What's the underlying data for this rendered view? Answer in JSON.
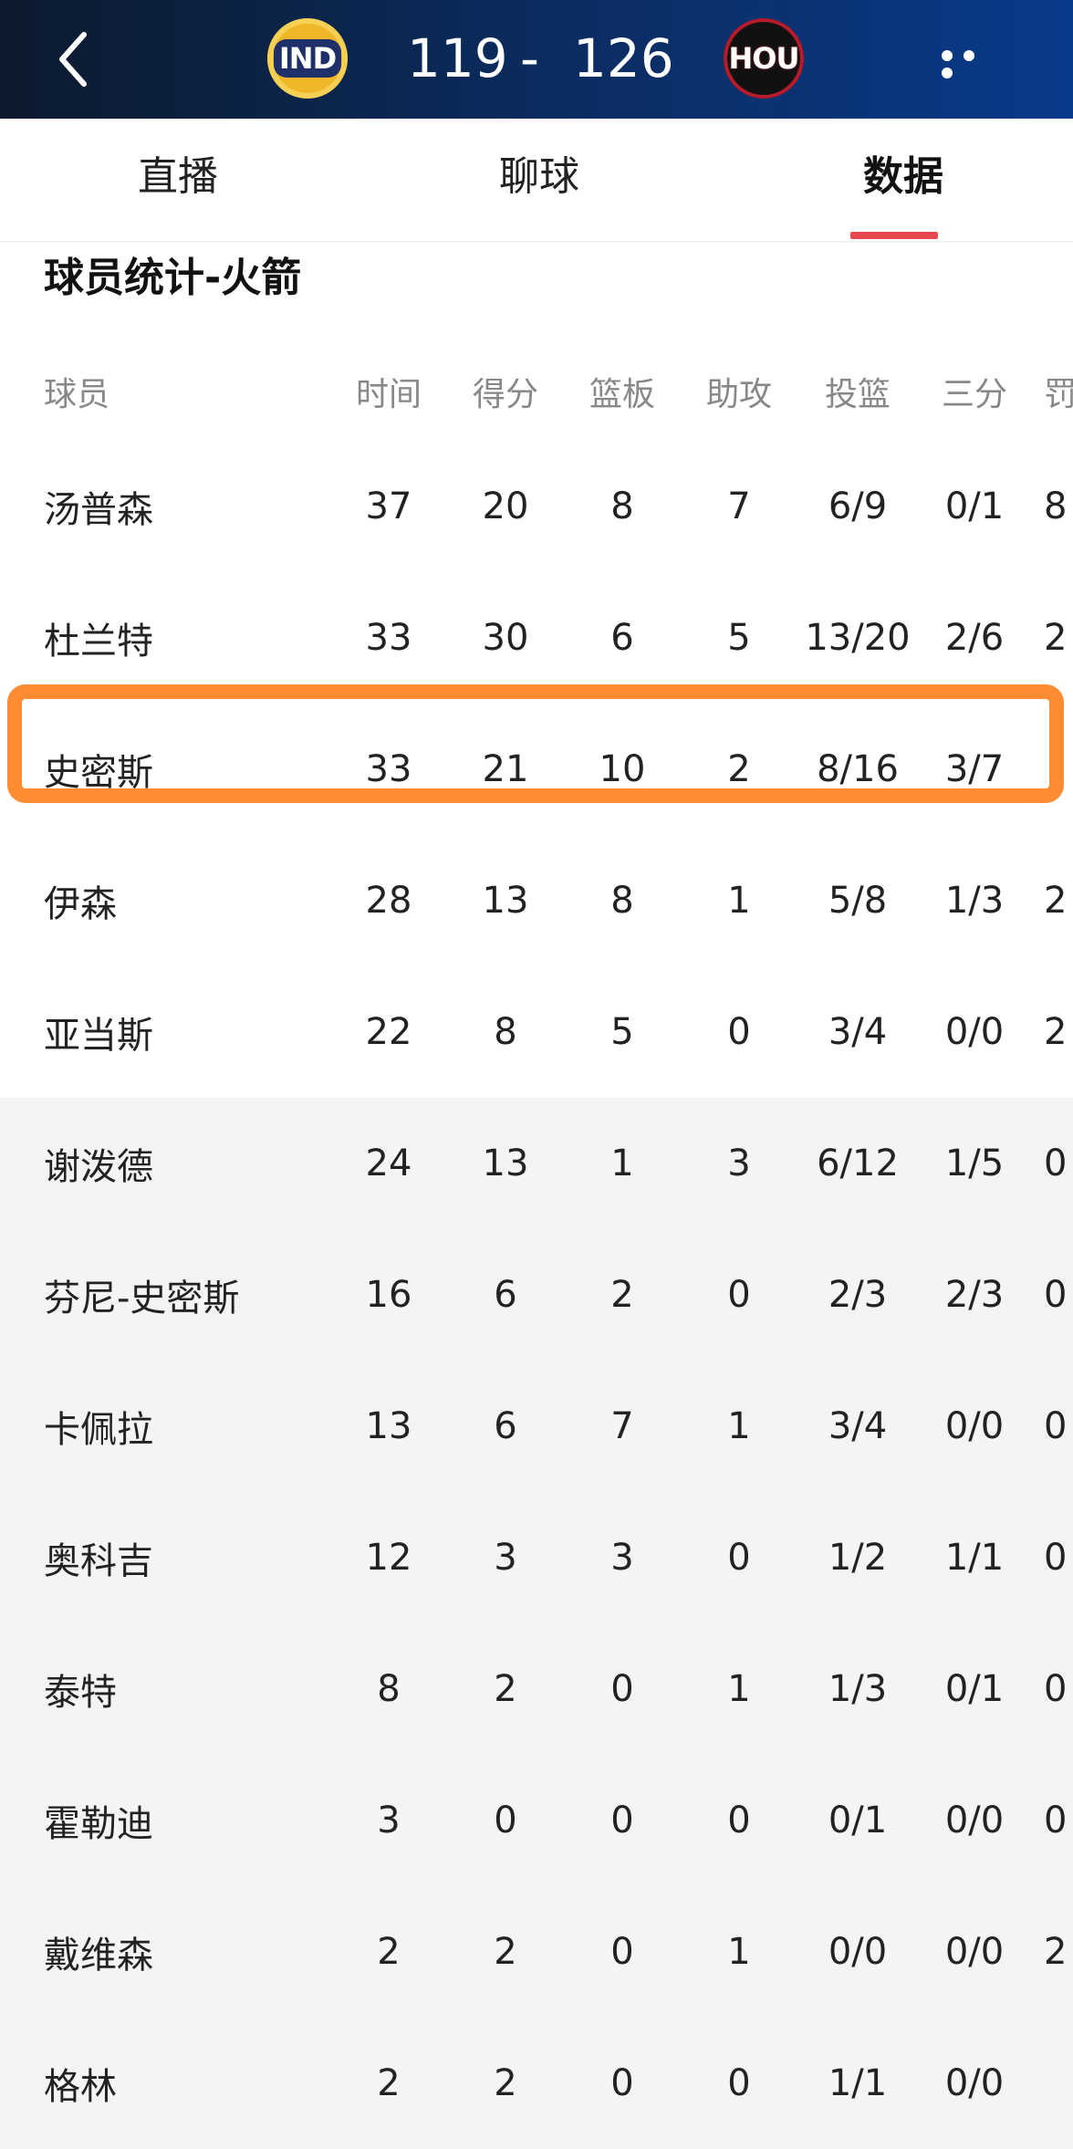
{
  "header": {
    "home_team": "IND",
    "away_team": "HOU",
    "home_score": "119",
    "separator": "-",
    "away_score": "126",
    "back_icon": "chevron-left-icon",
    "more_icon": "more-dots-icon",
    "colors": {
      "home_logo": "#f0b62a",
      "away_logo": "#111111",
      "accent": "#e8474f",
      "highlight": "#ff8c33"
    }
  },
  "tabs": [
    {
      "label": "直播"
    },
    {
      "label": "聊球"
    },
    {
      "label": "数据",
      "active": true
    }
  ],
  "section": {
    "title": "球员统计-火箭"
  },
  "table": {
    "columns": [
      "球员",
      "时间",
      "得分",
      "篮板",
      "助攻",
      "投篮",
      "三分",
      "罚"
    ],
    "rows": [
      {
        "name": "汤普森",
        "min": "37",
        "pts": "20",
        "reb": "8",
        "ast": "7",
        "fg": "6/9",
        "tp": "0/1",
        "ft": "8"
      },
      {
        "name": "杜兰特",
        "min": "33",
        "pts": "30",
        "reb": "6",
        "ast": "5",
        "fg": "13/20",
        "tp": "2/6",
        "ft": "2"
      },
      {
        "name": "史密斯",
        "min": "33",
        "pts": "21",
        "reb": "10",
        "ast": "2",
        "fg": "8/16",
        "tp": "3/7",
        "ft": ""
      },
      {
        "name": "伊森",
        "min": "28",
        "pts": "13",
        "reb": "8",
        "ast": "1",
        "fg": "5/8",
        "tp": "1/3",
        "ft": "2"
      },
      {
        "name": "亚当斯",
        "min": "22",
        "pts": "8",
        "reb": "5",
        "ast": "0",
        "fg": "3/4",
        "tp": "0/0",
        "ft": "2"
      },
      {
        "name": "谢泼德",
        "min": "24",
        "pts": "13",
        "reb": "1",
        "ast": "3",
        "fg": "6/12",
        "tp": "1/5",
        "ft": "0"
      },
      {
        "name": "芬尼-史密斯",
        "min": "16",
        "pts": "6",
        "reb": "2",
        "ast": "0",
        "fg": "2/3",
        "tp": "2/3",
        "ft": "0"
      },
      {
        "name": "卡佩拉",
        "min": "13",
        "pts": "6",
        "reb": "7",
        "ast": "1",
        "fg": "3/4",
        "tp": "0/0",
        "ft": "0"
      },
      {
        "name": "奥科吉",
        "min": "12",
        "pts": "3",
        "reb": "3",
        "ast": "0",
        "fg": "1/2",
        "tp": "1/1",
        "ft": "0"
      },
      {
        "name": "泰特",
        "min": "8",
        "pts": "2",
        "reb": "0",
        "ast": "1",
        "fg": "1/3",
        "tp": "0/1",
        "ft": "0"
      },
      {
        "name": "霍勒迪",
        "min": "3",
        "pts": "0",
        "reb": "0",
        "ast": "0",
        "fg": "0/1",
        "tp": "0/0",
        "ft": "0"
      },
      {
        "name": "戴维森",
        "min": "2",
        "pts": "2",
        "reb": "0",
        "ast": "1",
        "fg": "0/0",
        "tp": "0/0",
        "ft": "2"
      },
      {
        "name": "格林",
        "min": "2",
        "pts": "2",
        "reb": "0",
        "ast": "0",
        "fg": "1/1",
        "tp": "0/0",
        "ft": ""
      }
    ]
  }
}
